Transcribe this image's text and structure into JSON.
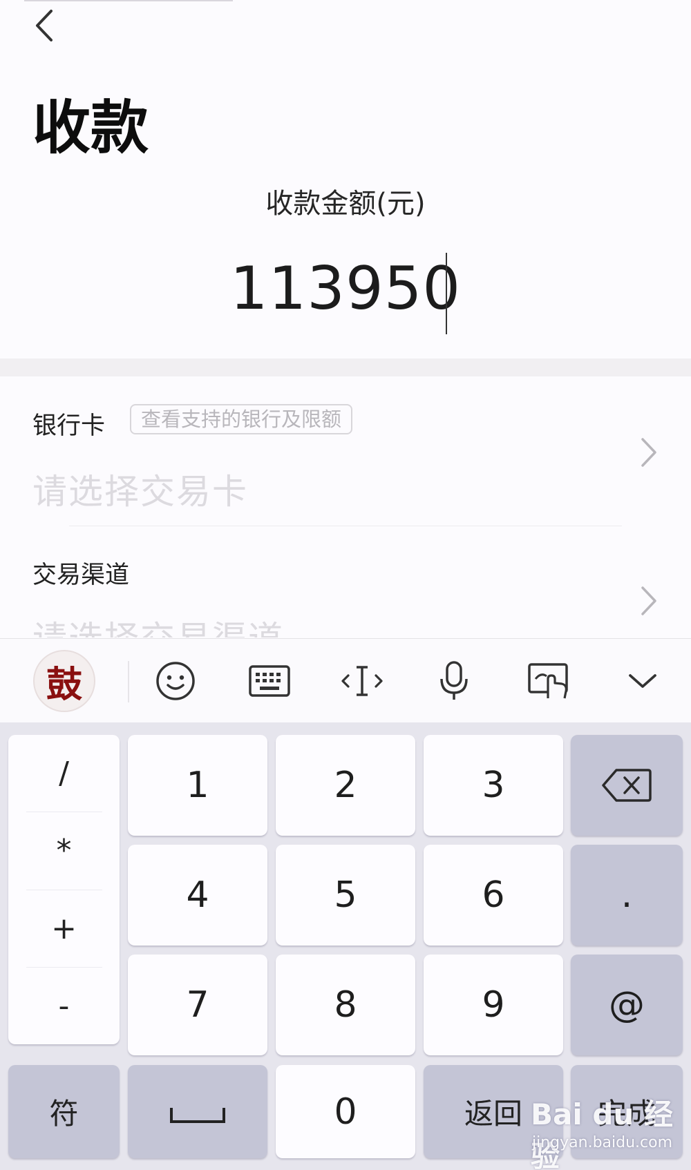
{
  "page": {
    "title": "收款",
    "amount_label": "收款金额(元)",
    "amount_value": "113950"
  },
  "form": {
    "bank_card": {
      "label": "银行卡",
      "tag": "查看支持的银行及限额",
      "placeholder": "请选择交易卡"
    },
    "channel": {
      "label": "交易渠道",
      "placeholder": "请选择交易渠道"
    }
  },
  "keyboard": {
    "toolbar": {
      "logo_text": "鼓",
      "icons": [
        "emoji-icon",
        "keyboard-icon",
        "cursor-icon",
        "microphone-icon",
        "handwriting-icon",
        "collapse-keyboard-icon"
      ]
    },
    "symbols": [
      "/",
      "*",
      "+",
      "-"
    ],
    "digits_row1": [
      "1",
      "2",
      "3"
    ],
    "digits_row2": [
      "4",
      "5",
      "6"
    ],
    "digits_row3": [
      "7",
      "8",
      "9"
    ],
    "dot": ".",
    "at": "@",
    "symbol_key": "符",
    "zero": "0",
    "return_key": "返回",
    "done_key": "完成"
  },
  "watermark": {
    "brand": "Bai du 经验",
    "url": "jingyan.baidu.com"
  },
  "colors": {
    "keyboard_bg": "#e6e5ed",
    "key_light": "#fdfcff",
    "key_dark": "#c4c5d6",
    "placeholder": "#dcdadf"
  }
}
